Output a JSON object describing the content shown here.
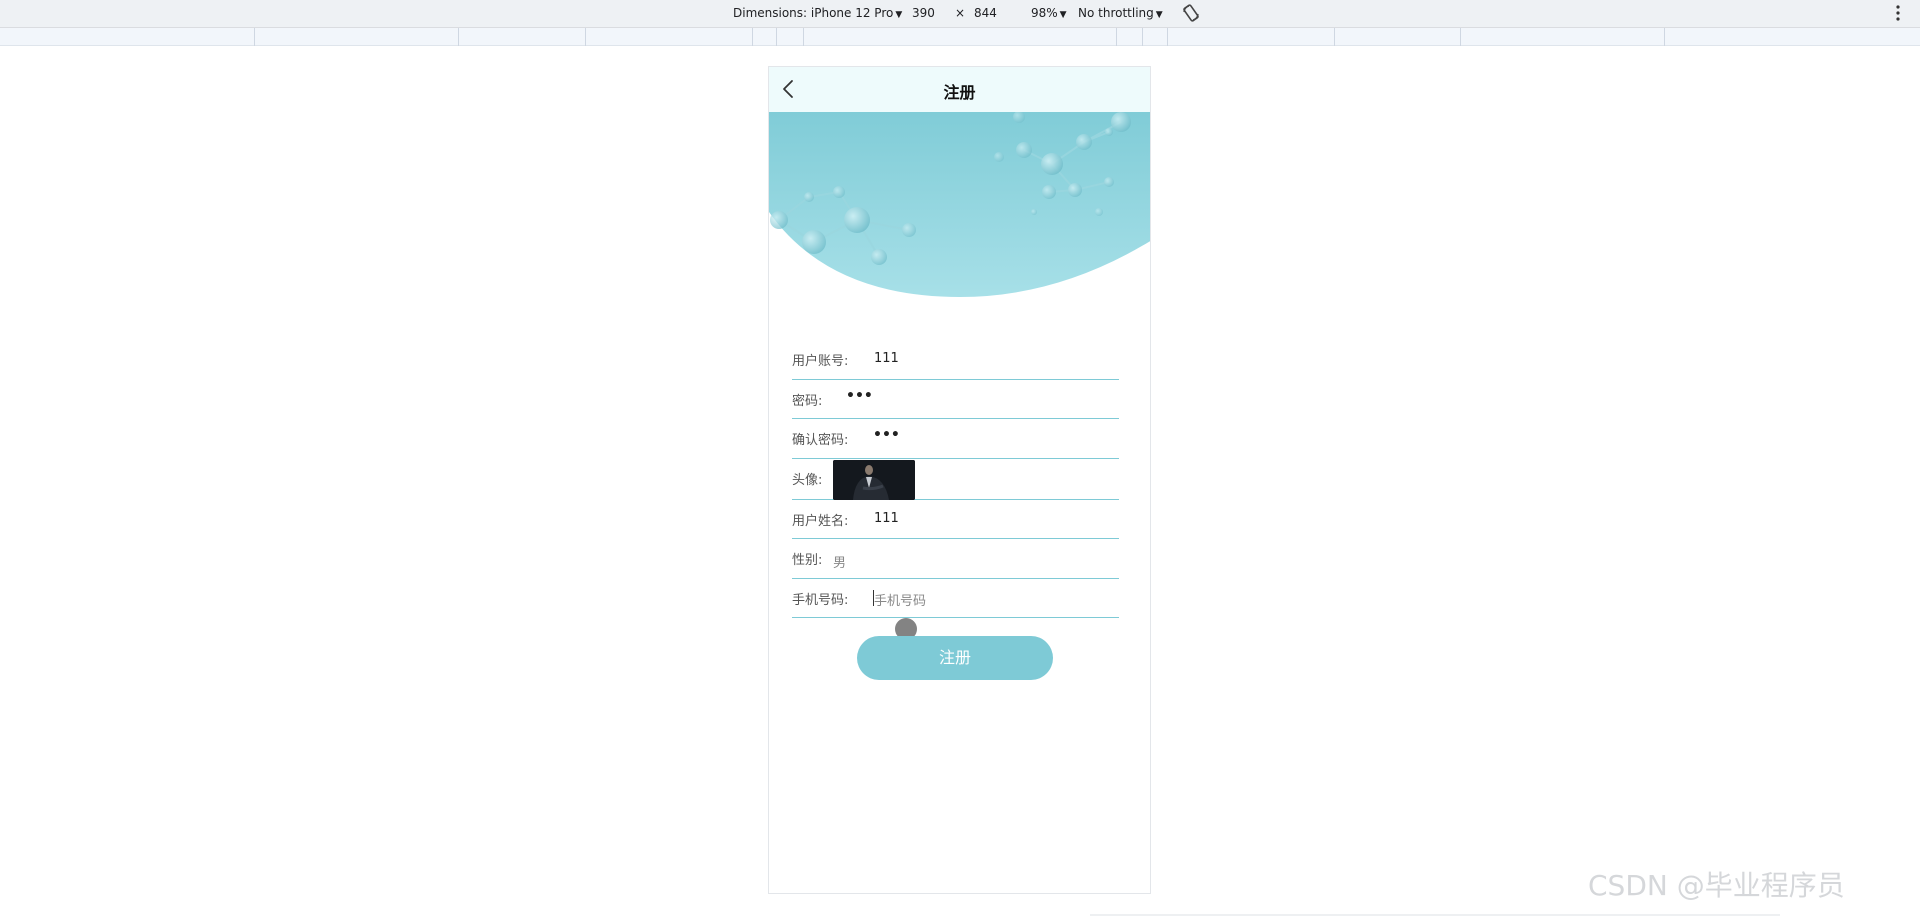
{
  "devtools": {
    "dimensions_label": "Dimensions: iPhone 12 Pro",
    "width": "390",
    "times": "×",
    "height": "844",
    "zoom": "98%",
    "throttling": "No throttling",
    "caret": "▼"
  },
  "page": {
    "title": "注册",
    "back_icon": "chevron-left-icon"
  },
  "form": {
    "fields": [
      {
        "label": "用户账号:",
        "value": "111"
      },
      {
        "label": "密码:",
        "value": "•••"
      },
      {
        "label": "确认密码:",
        "value": "•••"
      },
      {
        "label": "头像:",
        "value": ""
      },
      {
        "label": "用户姓名:",
        "value": "111"
      },
      {
        "label": "性别:",
        "value": "男"
      },
      {
        "label": "手机号码:",
        "placeholder": "手机号码"
      }
    ],
    "submit_label": "注册"
  },
  "colors": {
    "accent": "#7ecad6",
    "navbar_bg": "#eefbfc"
  },
  "watermark": "CSDN @毕业程序员"
}
